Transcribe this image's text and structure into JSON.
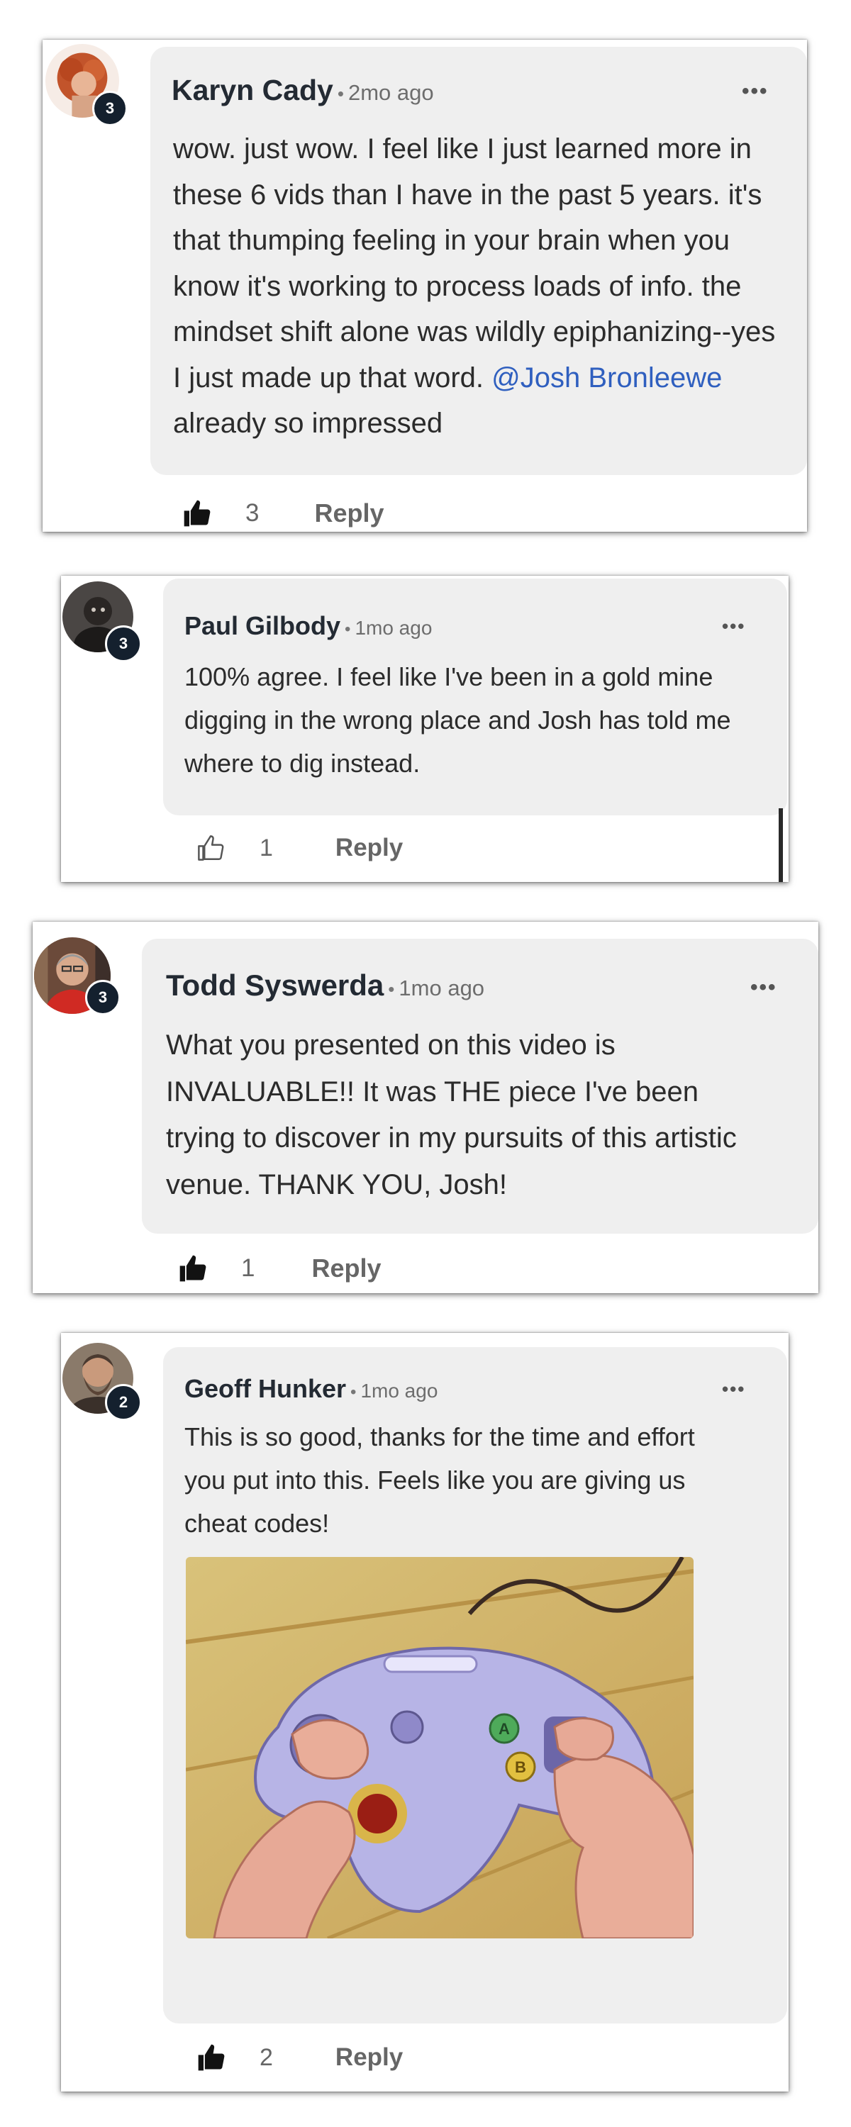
{
  "comments": [
    {
      "author": "Karyn Cady",
      "time": "2mo ago",
      "avatar_badge": "3",
      "text_before_mention": "wow. just wow. I feel like I just learned more in these 6 vids than I have in the past 5 years. it's that thumping feeling in your brain when you know it's working to process loads of info. the mindset shift alone was wildly epiphanizing--yes I just made up that word. ",
      "mention": "@Josh Bronleewe",
      "text_after_mention": " already so impressed",
      "likes": "3",
      "liked": true,
      "reply_label": "Reply"
    },
    {
      "author": "Paul Gilbody",
      "time": "1mo ago",
      "avatar_badge": "3",
      "text": "100% agree. I feel like I've been in a gold mine digging in the wrong place and Josh has told me where to dig instead.",
      "likes": "1",
      "liked": false,
      "reply_label": "Reply"
    },
    {
      "author": "Todd Syswerda",
      "time": "1mo ago",
      "avatar_badge": "3",
      "text": "What you presented on this video is INVALUABLE!! It was THE piece I've been trying to discover in my pursuits of this artistic venue. THANK YOU, Josh!",
      "likes": "1",
      "liked": true,
      "reply_label": "Reply"
    },
    {
      "author": "Geoff Hunker",
      "time": "1mo ago",
      "avatar_badge": "2",
      "text": "This is so good, thanks for the time and effort you put into this. Feels like you are giving us cheat codes!",
      "gif_button_a": "A",
      "gif_button_b": "B",
      "likes": "2",
      "liked": true,
      "reply_label": "Reply"
    }
  ],
  "icons": {
    "more": "more-options-icon",
    "like": "thumbs-up-icon"
  },
  "colors": {
    "bubble": "#efefef",
    "mention": "#2f5fbf",
    "badge": "#14202e"
  }
}
